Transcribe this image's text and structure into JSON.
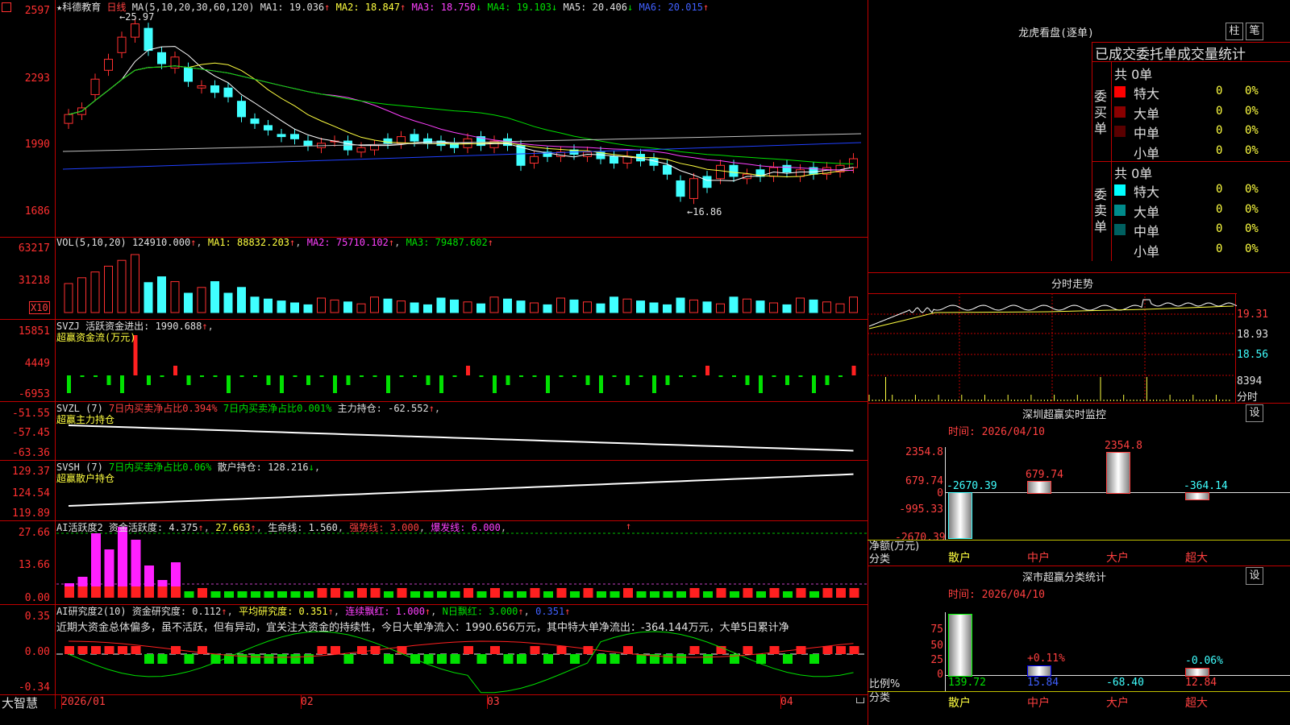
{
  "stock": {
    "name": "科德教育",
    "period": "日线",
    "star": "★",
    "logo": "大智慧"
  },
  "price_panel": {
    "ma_label": "MA(5,10,20,30,60,120)",
    "ma1": "MA1: 19.036",
    "ma2": "MA2: 18.847",
    "ma3": "MA3: 18.750",
    "ma4": "MA4: 19.103",
    "ma5": "MA5: 20.406",
    "ma6": "MA6: 20.015",
    "y_labels": [
      "2597",
      "2293",
      "1990",
      "1686"
    ],
    "high_note": "25.97",
    "low_note": "16.86"
  },
  "vol_panel": {
    "title": "VOL(5,10,20)",
    "v": "124910.000",
    "ma1": "MA1: 88832.203",
    "ma2": "MA2: 75710.102",
    "ma3": "MA3: 79487.602",
    "y_labels": [
      "63217",
      "31218"
    ],
    "unit": "X10"
  },
  "svzj": {
    "title": "SVZJ  活跃资金进出: 1990.688",
    "subtitle": "超赢资金流(万元)",
    "y_labels": [
      "15851",
      "4449",
      "-6953"
    ]
  },
  "svzl": {
    "title": "SVZL (7)",
    "a": "7日内买卖净占比0.394%",
    "b": "7日内买卖净占比0.001%",
    "c": "主力持仓: -62.552",
    "subtitle": "超赢主力持仓",
    "y_labels": [
      "-51.55",
      "-57.45",
      "-63.36"
    ]
  },
  "svsh": {
    "title": "SVSH (7)",
    "a": "7日内买卖净占比0.06%",
    "b": "散户持仓: 128.216",
    "subtitle": "超赢散户持仓",
    "y_labels": [
      "129.37",
      "124.54",
      "119.89"
    ]
  },
  "ai_active": {
    "title": "AI活跃度2",
    "a": "资金活跃度: 4.375",
    "b": "27.663",
    "c": "生命线: 1.560",
    "d": "强势线: 3.000",
    "e": "爆发线: 6.000",
    "y_labels": [
      "27.66",
      "13.66",
      "0.00"
    ]
  },
  "ai_research": {
    "title": "AI研究度2(10)",
    "a": "资金研究度: 0.112",
    "b": "平均研究度: 0.351",
    "c": "连续飘红: 1.000",
    "d": "N日飘红: 3.000",
    "e": "0.351",
    "comment": "近期大资金总体偏多，虽不活跃，但有异动，宜关注大资金的持续性，今日大单净流入：1990.656万元，其中特大单净流出：-364.144万元，大单5日累计净",
    "y_labels": [
      "0.35",
      "0.00",
      "-0.34"
    ]
  },
  "xaxis": [
    "2026/01",
    "02",
    "03",
    "04"
  ],
  "right": {
    "lhb_title": "龙虎看盘(逐单)",
    "btn_zhu": "柱",
    "btn_bi": "笔",
    "stats_title": "已成交委托单成交量统计",
    "buy_label": "委买单",
    "sell_label": "委卖单",
    "buy_total": "共 0单",
    "sell_total": "共 0单",
    "buy_rows": [
      {
        "label": "特大",
        "count": "0",
        "pct": "0%",
        "color": "#ff0000"
      },
      {
        "label": "大单",
        "count": "0",
        "pct": "0%",
        "color": "#8b0000"
      },
      {
        "label": "中单",
        "count": "0",
        "pct": "0%",
        "color": "#5a0000"
      },
      {
        "label": "小单",
        "count": "0",
        "pct": "0%",
        "color": ""
      }
    ],
    "sell_rows": [
      {
        "label": "特大",
        "count": "0",
        "pct": "0%",
        "color": "#00ffff"
      },
      {
        "label": "大单",
        "count": "0",
        "pct": "0%",
        "color": "#008b8b"
      },
      {
        "label": "中单",
        "count": "0",
        "pct": "0%",
        "color": "#006060"
      },
      {
        "label": "小单",
        "count": "0",
        "pct": "0%",
        "color": ""
      }
    ],
    "fenshi_title": "分时走势",
    "fenshi_y": [
      "19.31",
      "18.93",
      "18.56"
    ],
    "fenshi_vol": "8394",
    "fenshi_unit": "分时",
    "sz_title": "深圳超赢实时监控",
    "sz_btn": "设",
    "sz_time": "时间: 2026/04/10",
    "sz_y": [
      "2354.8",
      "679.74",
      "0",
      "-995.33",
      "-2670.39"
    ],
    "sz_left1": "净额(万元)",
    "sz_left2": "分类",
    "sz_bars": [
      {
        "label": "散户",
        "value": -2670.39,
        "text": "-2670.39"
      },
      {
        "label": "中户",
        "value": 679.74,
        "text": "679.74"
      },
      {
        "label": "大户",
        "value": 2354.8,
        "text": "2354.8"
      },
      {
        "label": "超大",
        "value": -364.14,
        "text": "-364.14"
      }
    ],
    "fl_title": "深市超赢分类统计",
    "fl_btn": "设",
    "fl_time": "时间: 2026/04/10",
    "fl_y": [
      "75",
      "50",
      "25",
      "0"
    ],
    "fl_left1": "比例%",
    "fl_left2": "分类",
    "fl_bars": [
      {
        "label": "散户",
        "value": 139.72,
        "text": "139.72",
        "pct_text": ""
      },
      {
        "label": "中户",
        "value": 15.84,
        "text": "15.84",
        "pct_text": "+0.11%"
      },
      {
        "label": "大户",
        "value": -68.4,
        "text": "-68.40",
        "pct_text": ""
      },
      {
        "label": "超大",
        "value": 12.84,
        "text": "12.84",
        "pct_text": "-0.06%"
      }
    ]
  },
  "colors": {
    "up": "#ff3030",
    "down": "#00ffff",
    "grid": "#c00000",
    "bg": "#000000"
  }
}
